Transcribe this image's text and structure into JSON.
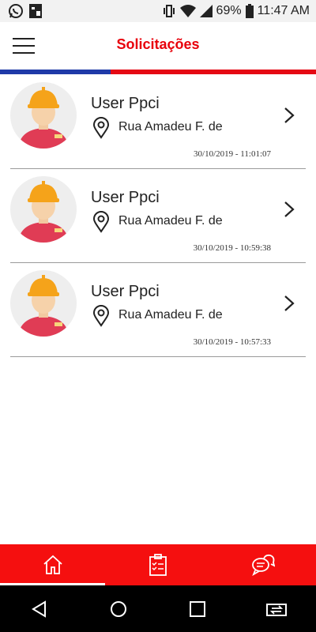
{
  "status_bar": {
    "battery": "69%",
    "time": "11:47 AM"
  },
  "header": {
    "title": "Solicitações"
  },
  "requests": [
    {
      "name": "User Ppci",
      "address": "Rua Amadeu F. de",
      "datetime": "30/10/2019 - 11:01:07"
    },
    {
      "name": "User Ppci",
      "address": "Rua Amadeu F. de",
      "datetime": "30/10/2019 - 10:59:38"
    },
    {
      "name": "User Ppci",
      "address": "Rua Amadeu F. de",
      "datetime": "30/10/2019 - 10:57:33"
    }
  ],
  "bottom_tabs": [
    {
      "icon": "home-icon",
      "active": true
    },
    {
      "icon": "clipboard-checklist-icon",
      "active": false
    },
    {
      "icon": "chat-bubbles-icon",
      "active": false
    }
  ],
  "colors": {
    "brand_red": "#e8000b",
    "bar_red": "#f50f0f",
    "stripe_blue": "#1f3aa8"
  }
}
